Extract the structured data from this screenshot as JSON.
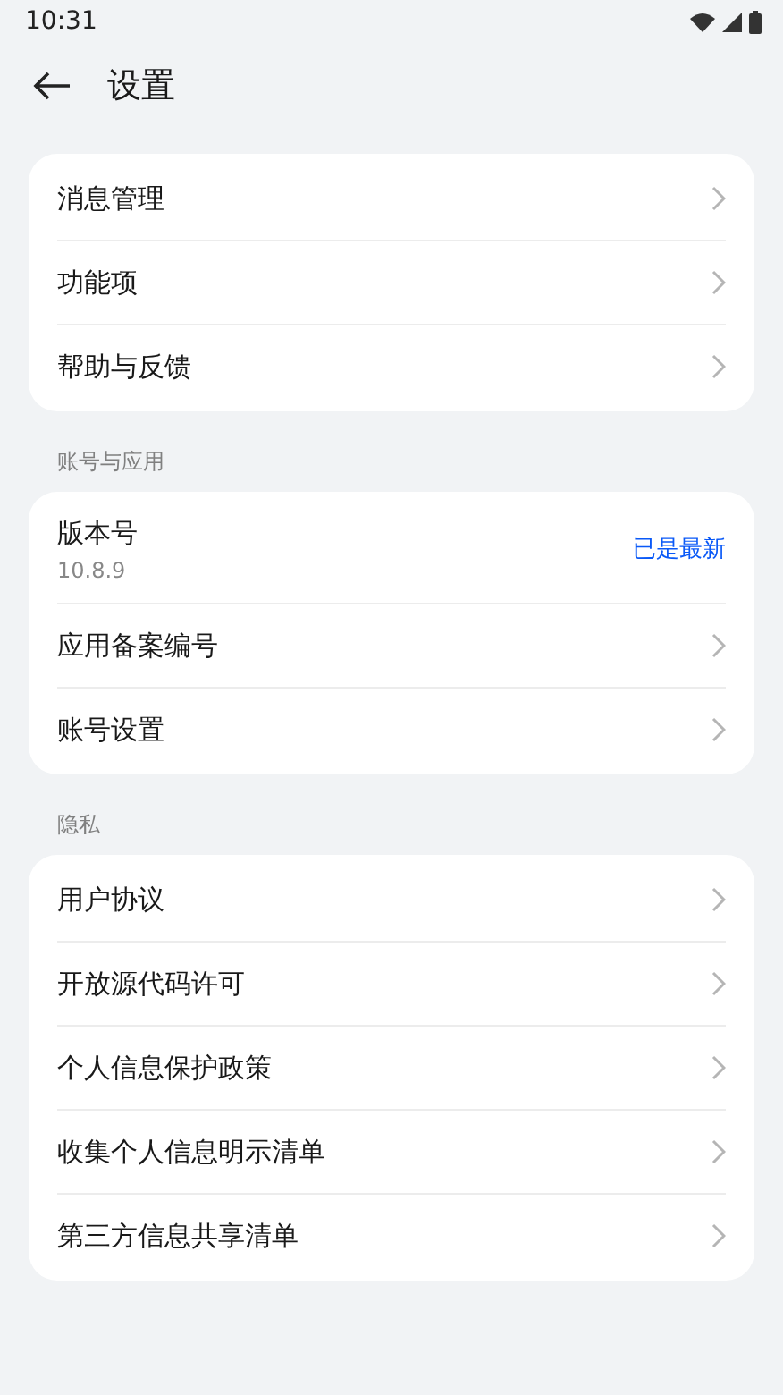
{
  "status_bar": {
    "time": "10:31"
  },
  "header": {
    "title": "设置"
  },
  "sections": [
    {
      "items": [
        {
          "kind": "link",
          "label": "消息管理"
        },
        {
          "kind": "link",
          "label": "功能项"
        },
        {
          "kind": "link",
          "label": "帮助与反馈"
        }
      ]
    },
    {
      "title": "账号与应用",
      "items": [
        {
          "kind": "info",
          "label": "版本号",
          "detail": "10.8.9",
          "value": "已是最新"
        },
        {
          "kind": "link",
          "label": "应用备案编号"
        },
        {
          "kind": "link",
          "label": "账号设置"
        }
      ]
    },
    {
      "title": "隐私",
      "items": [
        {
          "kind": "link",
          "label": "用户协议"
        },
        {
          "kind": "link",
          "label": "开放源代码许可"
        },
        {
          "kind": "link",
          "label": "个人信息保护政策"
        },
        {
          "kind": "link",
          "label": "收集个人信息明示清单"
        },
        {
          "kind": "link",
          "label": "第三方信息共享清单"
        }
      ]
    }
  ]
}
